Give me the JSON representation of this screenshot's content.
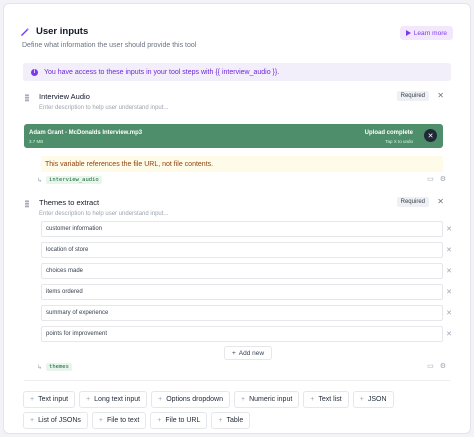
{
  "header": {
    "title": "User inputs",
    "subtitle": "Define what information the user should provide this tool",
    "learn_more": "Learn more"
  },
  "banner": {
    "text": "You have access to these inputs in your tool steps with {{ interview_audio }}."
  },
  "fields": [
    {
      "name": "Interview Audio",
      "description_placeholder": "Enter description to help user understand input...",
      "required": "Required",
      "upload": {
        "file_name": "Adam Grant - McDonalds Interview.mp3",
        "file_size": "3.7 MB",
        "status": "Upload complete",
        "status_detail": "Tap X to undo"
      },
      "note": "This variable references the file URL, not file contents.",
      "variable": "interview_audio"
    },
    {
      "name": "Themes to extract",
      "description_placeholder": "Enter description to help user understand input...",
      "required": "Required",
      "items": [
        "customer information",
        "location of store",
        "choices made",
        "items ordered",
        "summary of experience",
        "points for improvement"
      ],
      "add_new": "Add new",
      "variable": "themes"
    }
  ],
  "input_types": [
    "Text input",
    "Long text input",
    "Options dropdown",
    "Numeric input",
    "Text list",
    "JSON",
    "List of JSONs",
    "File to text",
    "File to URL",
    "Table"
  ],
  "colors": {
    "accent": "#7c3aed",
    "upload_bg": "#4e8e6a",
    "tag_text": "#166534"
  }
}
